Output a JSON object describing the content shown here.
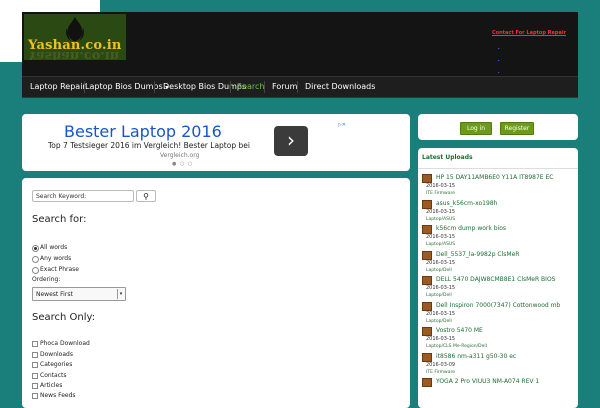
{
  "site": {
    "logo_text": "Yashan.co.in"
  },
  "top_links": {
    "contact": "Contact For Laptop Repair",
    "links": [
      "",
      "",
      "",
      ""
    ]
  },
  "nav": {
    "items": [
      {
        "label": "Laptop Repair"
      },
      {
        "label": "Laptop Bios Dumps",
        "has_dropdown": true
      },
      {
        "label": "Desktop Bios Dumps"
      },
      {
        "label": "Search",
        "active": true
      },
      {
        "label": "Forum"
      },
      {
        "label": "Direct Downloads"
      }
    ]
  },
  "ad": {
    "title": "Bester Laptop 2016",
    "subtitle": "Top 7 Testsieger 2016 im Vergleich! Bester Laptop bei",
    "subtitle_cut": "Vergleich.org"
  },
  "login": {
    "login_label": "Log in",
    "register_label": "Register"
  },
  "search": {
    "keyword_placeholder": "Search Keyword:",
    "search_for_title": "Search for:",
    "options": [
      "All words",
      "Any words",
      "Exact Phrase"
    ],
    "selected_option": 0,
    "ordering_label": "Ordering:",
    "ordering_value": "Newest First",
    "search_only_title": "Search Only:",
    "areas": [
      "Phoca Download",
      "Downloads",
      "Categories",
      "Contacts",
      "Articles",
      "News Feeds"
    ]
  },
  "uploads": {
    "title": "Latest Uploads",
    "items": [
      {
        "name": "HP 15 DAY11AMB6E0 Y11A IT8987E EC",
        "date": "2016-03-15",
        "category": "ITE Firmware"
      },
      {
        "name": "asus_k56cm-xo198h",
        "date": "2016-03-15",
        "category": "Laptop/ASUS"
      },
      {
        "name": "k56cm dump work bios",
        "date": "2016-03-15",
        "category": "Laptop/ASUS"
      },
      {
        "name": "Dell_5537_la-9982p ClsMeR",
        "date": "2016-03-15",
        "category": "Laptop/Dell"
      },
      {
        "name": "DELL 5470 DAJW8CMB8E1 ClsMeR BIOS",
        "date": "2016-03-15",
        "category": "Laptop/Dell"
      },
      {
        "name": "Dell Inspiron 7000(7347) Cottonwood mb",
        "date": "2016-03-15",
        "category": "Laptop/Dell"
      },
      {
        "name": "Vostro 5470 ME",
        "date": "2016-03-15",
        "category": "Laptop/CLS Me-Region/Dell"
      },
      {
        "name": "it8586 nm-a311 g50-30 ec",
        "date": "2016-03-09",
        "category": "ITE Firmware"
      },
      {
        "name": "YOGA 2 Pro VIUU3 NM-A074 REV 1",
        "date": "",
        "category": ""
      }
    ]
  },
  "colors": {
    "background": "#1a7f7a",
    "accent": "#6c9a1a",
    "link_green": "#1a6e32"
  }
}
